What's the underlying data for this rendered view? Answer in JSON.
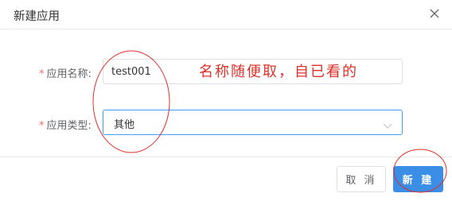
{
  "dialog": {
    "title": "新建应用",
    "close_icon": "close-icon"
  },
  "form": {
    "name": {
      "required_mark": "*",
      "label": "应用名称:",
      "value": "test001"
    },
    "type": {
      "required_mark": "*",
      "label": "应用类型:",
      "value": "其他",
      "dropdown_icon": "chevron-down-icon"
    }
  },
  "footer": {
    "cancel_label": "取 消",
    "create_label": "新 建"
  },
  "annotation": {
    "text": "名称随便取，自已看的",
    "color": "#e0302a"
  },
  "colors": {
    "primary": "#3a8ee6",
    "required": "#f56c6c",
    "focus_border": "#409eff"
  }
}
